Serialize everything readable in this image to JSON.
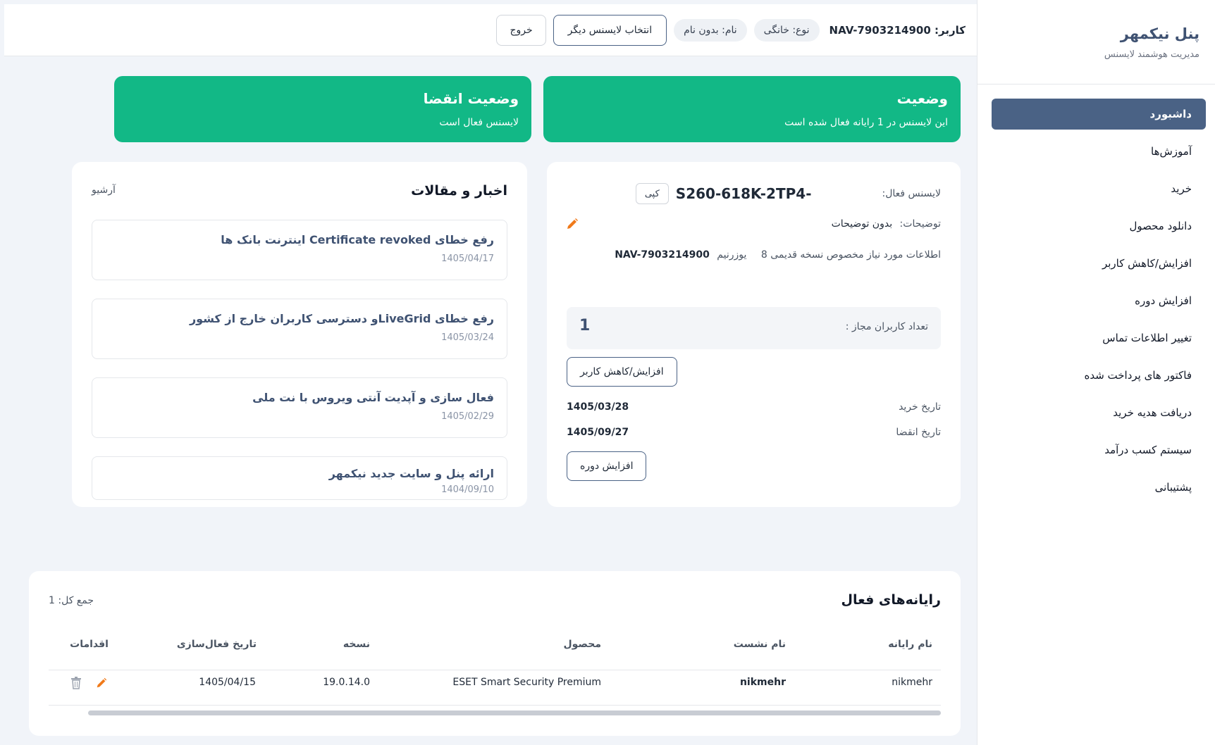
{
  "sidebar": {
    "title": "پنل نیکمهر",
    "subtitle": "مدیریت هوشمند لایسنس",
    "items": [
      {
        "label": "داشبورد",
        "active": true
      },
      {
        "label": "آموزش‌ها"
      },
      {
        "label": "خرید"
      },
      {
        "label": "دانلود محصول"
      },
      {
        "label": "افزایش/کاهش کاربر"
      },
      {
        "label": "افزایش دوره"
      },
      {
        "label": "تغییر اطلاعات تماس"
      },
      {
        "label": "فاکتور های پرداخت شده"
      },
      {
        "label": "دریافت هدیه خرید"
      },
      {
        "label": "سیستم کسب درآمد"
      },
      {
        "label": "پشتیبانی"
      }
    ]
  },
  "header": {
    "user_label": "کاربر: NAV-7903214900",
    "type_pill": "نوع: خانگی",
    "name_pill": "نام: بدون نام",
    "switch_button": "انتخاب لایسنس دیگر",
    "logout_button": "خروج"
  },
  "status": {
    "title": "وضعیت",
    "text": "این لایسنس در 1 رایانه فعال شده است"
  },
  "expiry_status": {
    "title": "وضعیت انقضا",
    "text": "لایسنس فعال است"
  },
  "license": {
    "active_label": "لایسنس فعال:",
    "key": "S260-618K-2TP4-",
    "copy_button": "کپی",
    "desc_label": "توضیحات:",
    "desc_value": "بدون توضیحات",
    "info_label": "اطلاعات مورد نیاز مخصوص نسخه قدیمی 8",
    "username_label": "یوزرنیم",
    "username_value": "NAV-7903214900",
    "users_label": "تعداد کاربران مجاز :",
    "users_value": "1",
    "users_button": "افزایش/کاهش کاربر",
    "purchase_label": "تاریخ خرید",
    "purchase_value": "1405/03/28",
    "expiry_label": "تاریخ انقضا",
    "expiry_value": "1405/09/27",
    "extend_button": "افزایش دوره"
  },
  "news": {
    "title": "اخبار و مقالات",
    "archive": "آرشیو",
    "items": [
      {
        "title": "رفع خطای Certificate revoked اینترنت بانک ها",
        "date": "1405/04/17"
      },
      {
        "title": "رفع خطای LiveGridو دسترسی کاربران خارج از کشور",
        "date": "1405/03/24"
      },
      {
        "title": "فعال سازی و آپدیت آنتی ویروس با نت ملی",
        "date": "1405/02/29"
      },
      {
        "title": "ارائه پنل و سایت جدید نیکمهر",
        "date": "1404/09/10"
      }
    ]
  },
  "computers": {
    "title": "رایانه‌های فعال",
    "total": "جمع کل: 1",
    "headers": {
      "name": "نام رایانه",
      "session": "نام نشست",
      "product": "محصول",
      "version": "نسخه",
      "activation": "تاریخ فعال‌سازی",
      "actions": "اقدامات"
    },
    "rows": [
      {
        "name": "nikmehr",
        "session": "nikmehr",
        "product": "ESET Smart Security Premium",
        "version": "19.0.14.0",
        "activation": "1405/04/15"
      }
    ]
  },
  "colors": {
    "sidebar_active": "#4a6285",
    "status_green": "#12b886",
    "edit_orange": "#f07a1a"
  }
}
